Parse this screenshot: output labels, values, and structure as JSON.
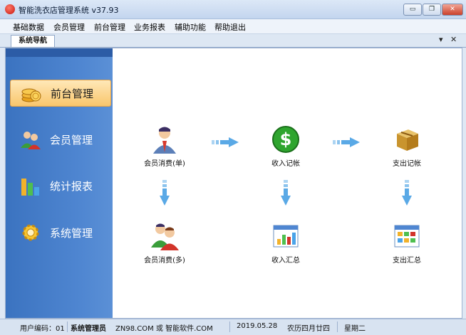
{
  "window": {
    "title": "智能洗衣店管理系统 v37.93",
    "minimize_glyph": "▭",
    "restore_glyph": "❐",
    "close_glyph": "✕"
  },
  "menu": [
    "基础数据",
    "会员管理",
    "前台管理",
    "业务报表",
    "辅助功能",
    "帮助退出"
  ],
  "tab": {
    "label": "系统导航",
    "dropdown_glyph": "▾",
    "close_glyph": "✕"
  },
  "sidebar": {
    "items": [
      {
        "label": "前台管理",
        "icon": "coins-icon",
        "active": true
      },
      {
        "label": "会员管理",
        "icon": "users-icon",
        "active": false
      },
      {
        "label": "统计报表",
        "icon": "bar-chart-icon",
        "active": false
      },
      {
        "label": "系统管理",
        "icon": "gear-icon",
        "active": false
      }
    ]
  },
  "flow": {
    "member_consume_single": "会员消费(单)",
    "income_record": "收入记帐",
    "expense_record": "支出记帐",
    "member_consume_multi": "会员消费(多)",
    "income_summary": "收入汇总",
    "expense_summary": "支出汇总"
  },
  "status": {
    "user_code": "用户编码：01",
    "user_role": "系统管理员",
    "website": "ZN98.COM 或 智能软件.COM",
    "date": "2019.05.28",
    "lunar": "农历四月廿四",
    "weekday": "星期二"
  },
  "colors": {
    "sidebar_blue": "#4f86d1",
    "active_orange": "#f9c66c",
    "arrow_blue": "#5aa9e6",
    "dollar_green": "#2ea52e"
  }
}
